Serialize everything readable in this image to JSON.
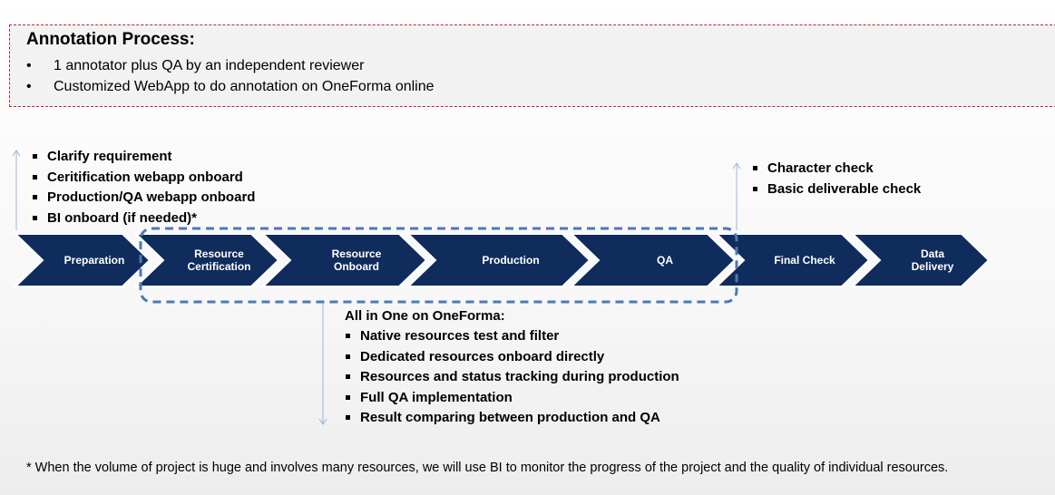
{
  "annotation_process": {
    "title": "Annotation Process:",
    "items": [
      "1 annotator plus QA by an independent reviewer",
      "Customized WebApp to do annotation on OneForma online"
    ]
  },
  "preparation_notes": [
    "Clarify requirement",
    "Ceritification webapp onboard",
    "Production/QA webapp onboard",
    "BI onboard (if needed)*"
  ],
  "final_check_notes": [
    "Character check",
    "Basic deliverable check"
  ],
  "stages": [
    {
      "lines": [
        "Preparation"
      ]
    },
    {
      "lines": [
        "Resource",
        "Certification"
      ]
    },
    {
      "lines": [
        "Resource",
        "Onboard"
      ]
    },
    {
      "lines": [
        "Production"
      ]
    },
    {
      "lines": [
        "QA"
      ]
    },
    {
      "lines": [
        "Final Check"
      ]
    },
    {
      "lines": [
        "Data",
        "Delivery"
      ]
    }
  ],
  "oneforma": {
    "title": "All in One on OneForma:",
    "items": [
      "Native resources test and filter",
      "Dedicated resources onboard directly",
      "Resources and status tracking during production",
      "Full QA implementation",
      "Result comparing between production and QA"
    ]
  },
  "colors": {
    "chevron": "#0f2c5c",
    "dashed_group": "#4f78b4",
    "dashed_box": "#c0282d",
    "arrow": "#9db5d8"
  },
  "footnote": "* When the volume of project is huge and involves many resources, we will use BI to monitor the progress of the project and the quality of individual resources."
}
